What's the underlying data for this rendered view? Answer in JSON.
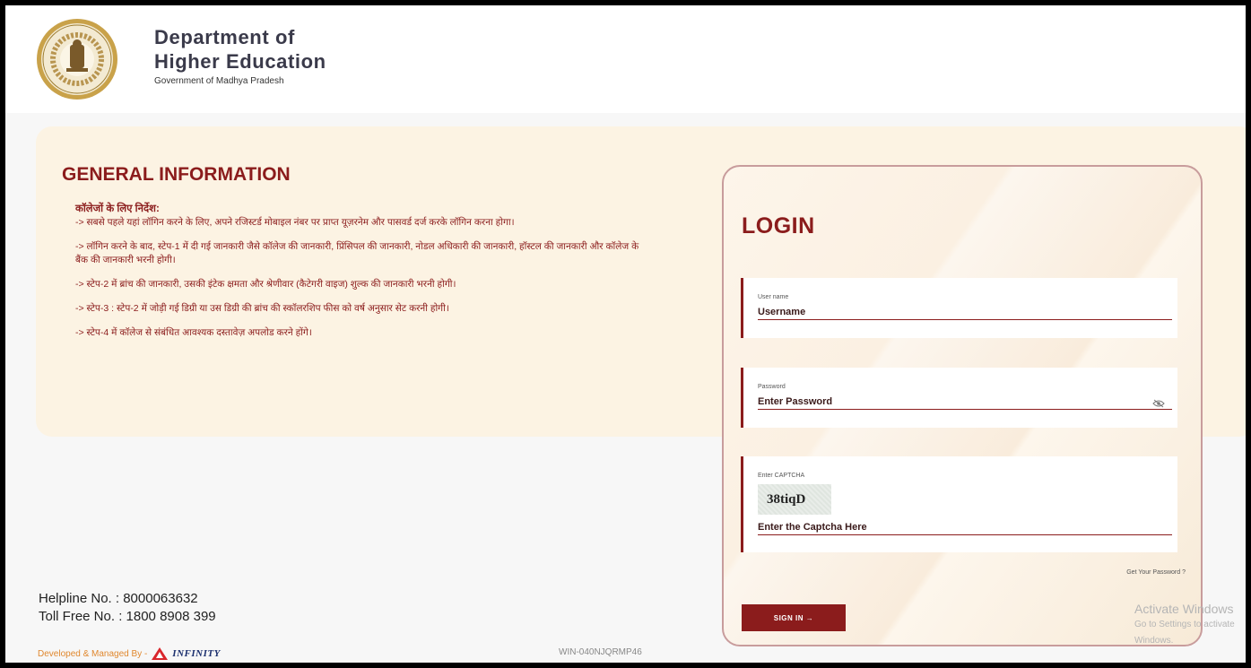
{
  "header": {
    "title_line1": "Department of",
    "title_line2": "Higher Education",
    "subtitle": "Government of Madhya Pradesh"
  },
  "info": {
    "title": "GENERAL INFORMATION",
    "heading": "कॉलेजों के लिए निर्देश:",
    "items": [
      "-> सबसे पहले यहां लॉगिन करने के लिए, अपने रजिस्टर्ड मोबाइल नंबर पर प्राप्त यूज़रनेम और पासवर्ड दर्ज करके लॉगिन करना होगा।",
      "-> लॉगिन करने के बाद, स्टेप-1 में दी गई जानकारी जैसे कॉलेज की जानकारी, प्रिंसिपल की जानकारी, नोडल अधिकारी की जानकारी, हॉस्टल की जानकारी और कॉलेज के बैंक की जानकारी भरनी होगी।",
      "-> स्टेप-2 में ब्रांच की जानकारी, उसकी इंटेक क्षमता और श्रेणीवार (कैटेगरी वाइज) शुल्क की जानकारी भरनी होगी।",
      "-> स्टेप-3 : स्टेप-2 में जोड़ी गई डिग्री या उस डिग्री की ब्रांच की स्कॉलरशिप फीस को वर्ष अनुसार सेट करनी होगी।",
      "-> स्टेप-4 में कॉलेज से संबंधित आवश्यक दस्तावेज़ अपलोड करने होंगे।"
    ]
  },
  "footer": {
    "helpline": "Helpline No. : 8000063632",
    "tollfree": "Toll Free No. : 1800 8908 399",
    "developed": "Developed & Managed By -",
    "company": "INFINITY",
    "machine": "WIN-040NJQRMP46"
  },
  "login": {
    "title": "LOGIN",
    "username_label": "User name",
    "username_placeholder": "Username",
    "password_label": "Password",
    "password_placeholder": "Enter Password",
    "captcha_label": "Enter CAPTCHA",
    "captcha_text": "38tiqD",
    "captcha_placeholder": "Enter the Captcha Here",
    "forgot": "Get Your Password ?",
    "signin": "SIGN IN →"
  },
  "watermark": {
    "line1": "Activate Windows",
    "line2": "Go to Settings to activate Windows."
  },
  "colors": {
    "accent": "#8b1c1c",
    "panel": "#fcf3e3"
  }
}
